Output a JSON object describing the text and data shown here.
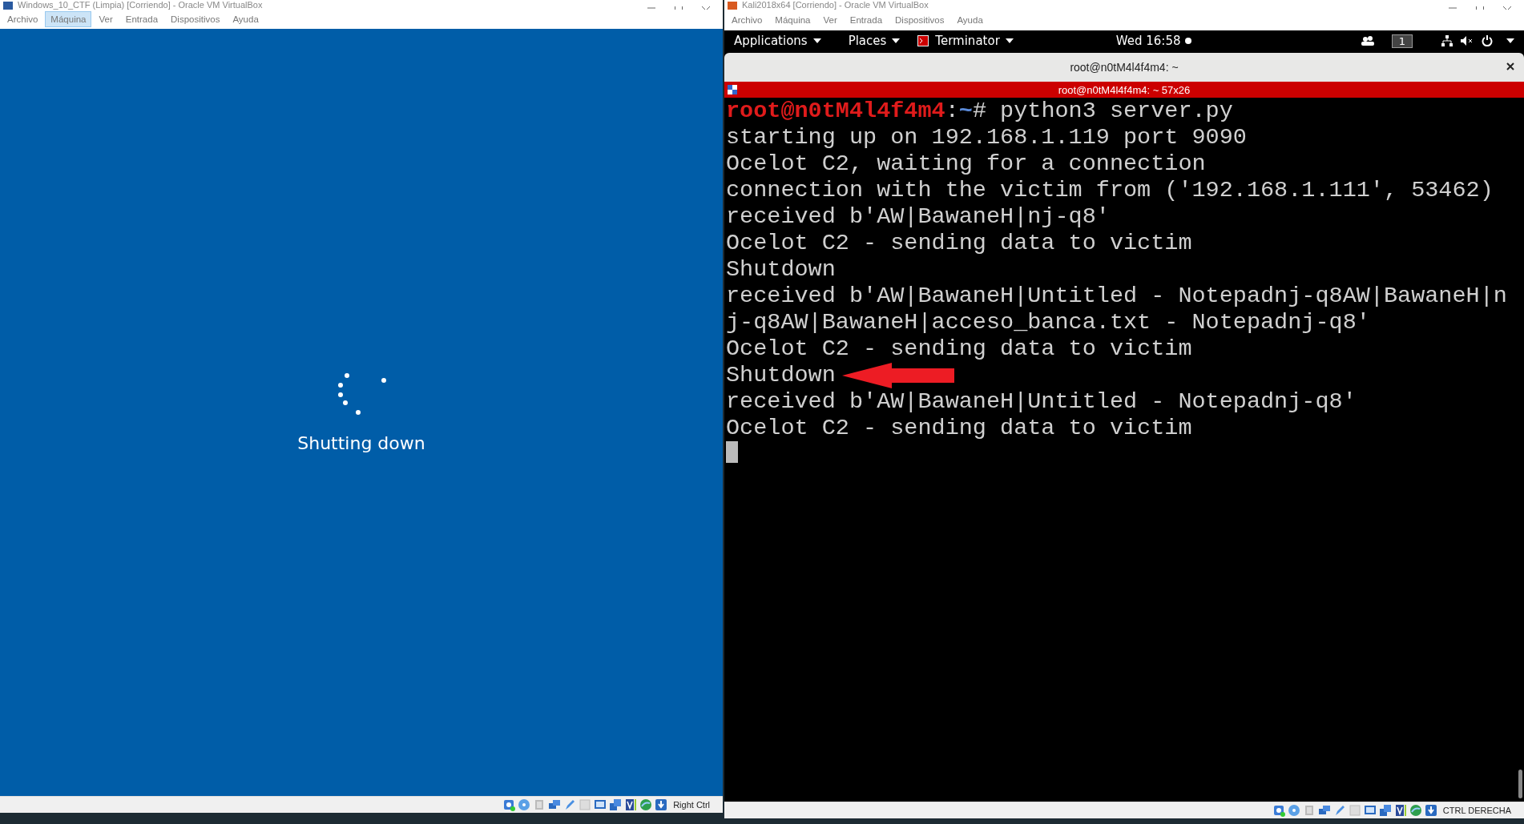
{
  "left_window": {
    "title": "Windows_10_CTF (Limpia) [Corriendo] - Oracle VM VirtualBox",
    "menu": [
      {
        "label": "Archivo",
        "selected": false
      },
      {
        "label": "Máquina",
        "selected": true
      },
      {
        "label": "Ver",
        "selected": false
      },
      {
        "label": "Entrada",
        "selected": false
      },
      {
        "label": "Dispositivos",
        "selected": false
      },
      {
        "label": "Ayuda",
        "selected": false
      }
    ],
    "screen": {
      "status": "Shutting down"
    },
    "status_bar": {
      "host_key": "Right Ctrl"
    }
  },
  "right_window": {
    "title": "Kali2018x64 [Corriendo] - Oracle VM VirtualBox",
    "menu": [
      {
        "label": "Archivo",
        "selected": false
      },
      {
        "label": "Máquina",
        "selected": false
      },
      {
        "label": "Ver",
        "selected": false
      },
      {
        "label": "Entrada",
        "selected": false
      },
      {
        "label": "Dispositivos",
        "selected": false
      },
      {
        "label": "Ayuda",
        "selected": false
      }
    ],
    "top_bar": {
      "applications": "Applications",
      "places": "Places",
      "app": "Terminator",
      "clock": "Wed 16:58",
      "workspace": "1"
    },
    "terminal": {
      "window_title": "root@n0tM4l4f4m4: ~",
      "tab_title": "root@n0tM4l4f4m4: ~ 57x26",
      "prompt": {
        "user": "root@n0tM4l4f4m4",
        "separator": ":",
        "path": "~",
        "command": "# python3 server.py"
      },
      "lines": [
        {
          "text": "starting up on 192.168.1.119 port 9090",
          "arrow": false
        },
        {
          "text": "Ocelot C2, waiting for a connection",
          "arrow": false
        },
        {
          "text": "connection with the victim from ('192.168.1.111', 53462)",
          "arrow": false
        },
        {
          "text": "received b'AW|BawaneH|nj-q8'",
          "arrow": false
        },
        {
          "text": "Ocelot C2 - sending data to victim",
          "arrow": false
        },
        {
          "text": "Shutdown",
          "arrow": false
        },
        {
          "text": "received b'AW|BawaneH|Untitled - Notepadnj-q8AW|BawaneH|n",
          "arrow": false
        },
        {
          "text": "j-q8AW|BawaneH|acceso_banca.txt - Notepadnj-q8'",
          "arrow": false
        },
        {
          "text": "Ocelot C2 - sending data to victim",
          "arrow": false
        },
        {
          "text": "Shutdown",
          "arrow": true
        },
        {
          "text": "received b'AW|BawaneH|Untitled - Notepadnj-q8'",
          "arrow": false
        },
        {
          "text": "Ocelot C2 - sending data to victim",
          "arrow": false
        }
      ],
      "cursor": true
    },
    "status_bar": {
      "host_key": "CTRL DERECHA"
    }
  }
}
